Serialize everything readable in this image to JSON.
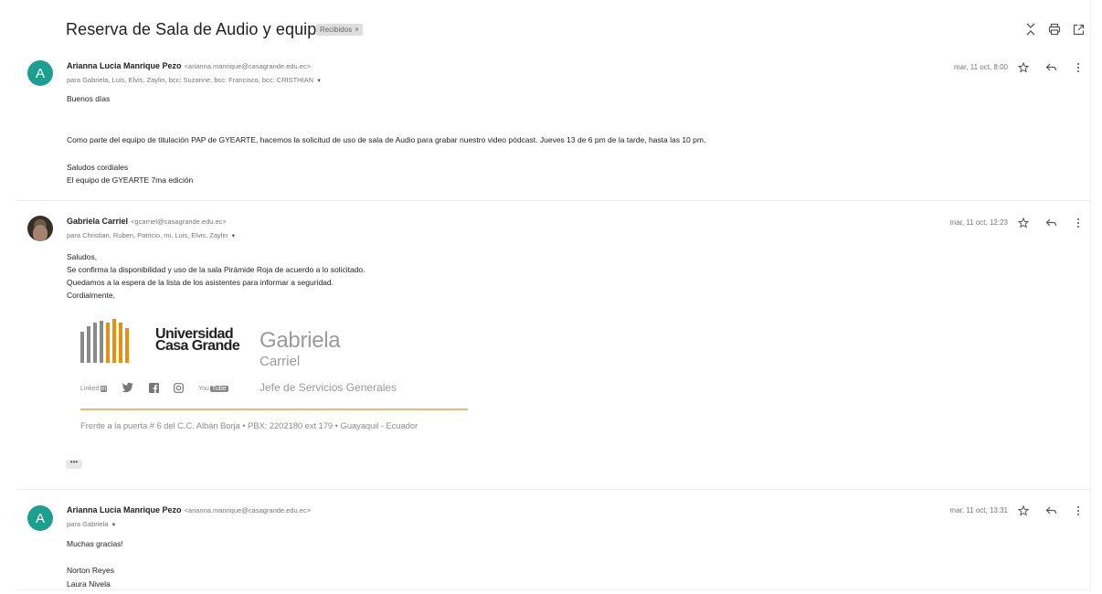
{
  "thread": {
    "subject": "Reserva de Sala de Audio y equipos",
    "label": "Recibidos",
    "label_close": "×"
  },
  "toolbar": {
    "icons": [
      "collapse-all-icon",
      "print-icon",
      "open-in-new-window-icon"
    ]
  },
  "messages": [
    {
      "sender_name": "Arianna Lucia Manrique Pezo",
      "sender_email": "<arianna.manrique@casagrande.edu.ec>",
      "avatar_letter": "A",
      "recipients": "para Gabriela, Luis, Elvis, Zaylin, bcc: Suzanne, bcc: Francisco, bcc: CRISTHIAN",
      "date": "mar, 11 oct, 8:00",
      "body": [
        "Buenos días",
        "Como parte del equipo de titulación PAP de GYEARTE, hacemos la solicitud de uso de sala de Audio para grabar nuestro video pódcast. Jueves 13 de 6 pm de la tarde, hasta las 10 pm.",
        "Saludos cordiales",
        "El equipo de GYEARTE 7ma edición"
      ]
    },
    {
      "sender_name": "Gabriela Carriel",
      "sender_email": "<gcarriel@casagrande.edu.ec>",
      "recipients": "para Christian, Ruben, Patricio, mi, Luis, Elvis, Zaylin",
      "date": "mar, 11 oct, 12:23",
      "body": [
        "Saludos,",
        "Se confirma la disponibilidad y uso de la sala Pirámide Roja de acuerdo a lo solicitado.",
        "Quedamos a la espera de la lista de los asistentes para informar a seguridad.",
        "Cordialmente,"
      ],
      "signature": {
        "org_line1": "Universidad",
        "org_line2": "Casa Grande",
        "first_name": "Gabriela",
        "last_name": "Carriel",
        "role": "Jefe de Servicios Generales",
        "social": [
          "Linked",
          "in",
          "You",
          "Tube"
        ],
        "address": "Frente a la puerta # 6 del C.C. Albán Borja  •  PBX: 2202180 ext 179  •  Guayaquil - Ecuador",
        "bar_colors": [
          "#8a8a8a",
          "#e8900e"
        ]
      },
      "trimmed_content": "•••"
    },
    {
      "sender_name": "Arianna Lucia Manrique Pezo",
      "sender_email": "<arianna.manrique@casagrande.edu.ec>",
      "avatar_letter": "A",
      "recipients": "para Gabriela",
      "date": "mar, 11 oct, 13:31",
      "body": [
        "Muchas gracias!",
        "Norton Reyes",
        "Laura Nivela"
      ]
    }
  ],
  "colors": {
    "avatar": "#1e9e8e",
    "accent_rule": "#e9b76d"
  }
}
